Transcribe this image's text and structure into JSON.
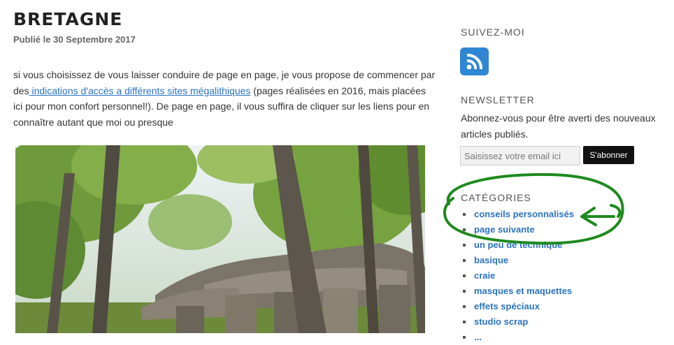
{
  "post": {
    "title": "BRETAGNE",
    "meta": "Publié le 30 Septembre 2017",
    "text_before": "si vous choisissez de vous laisser conduire de page en page, je vous propose de commencer par des",
    "link": " indications d'accès a différents sites mégalithiques",
    "text_after": " (pages réalisées en 2016, mais placées ici pour mon confort personnel!). De page en page, il vous suffira de cliquer sur les liens pour en connaître autant que moi ou presque"
  },
  "sidebar": {
    "follow_title": "SUIVEZ-MOI",
    "rss_icon": "rss-icon",
    "newsletter_title": "NEWSLETTER",
    "newsletter_desc": "Abonnez-vous pour être averti des nouveaux articles publiés.",
    "email_placeholder": "Saisissez votre email ici",
    "subscribe_label": "S'abonner",
    "categories_title": "CATÉGORIES",
    "categories": [
      "conseils personnalisés",
      "page suivante",
      "un peu de technique",
      "basique",
      "craie",
      "masques et maquettes",
      "effets spéciaux",
      "studio scrap",
      "..."
    ]
  },
  "colors": {
    "link": "#2a72c1",
    "rss": "#2f86d3",
    "annotation": "#1e8a1e"
  }
}
